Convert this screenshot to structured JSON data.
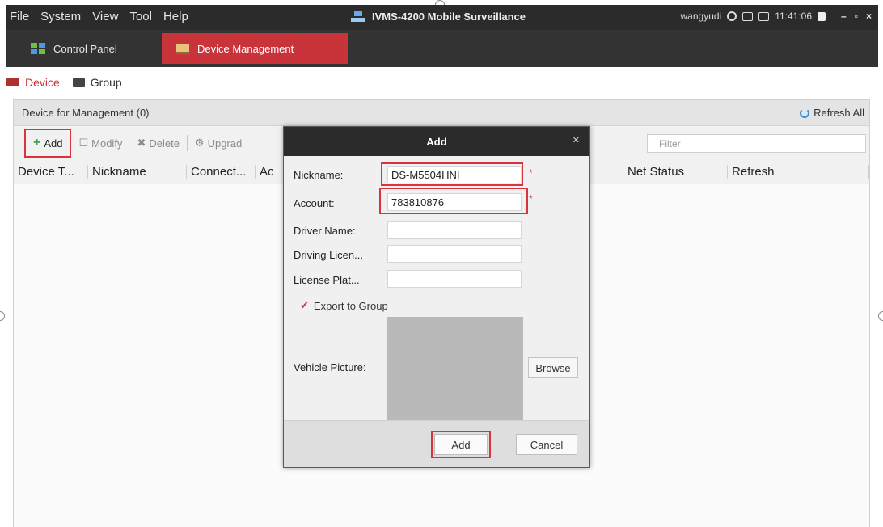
{
  "menu": [
    "File",
    "System",
    "View",
    "Tool",
    "Help"
  ],
  "app_title": "IVMS-4200 Mobile Surveillance",
  "status": {
    "user": "wangyudi",
    "time": "11:41:06"
  },
  "tabs": {
    "control_panel": "Control Panel",
    "device_management": "Device Management"
  },
  "subtabs": {
    "device": "Device",
    "group": "Group"
  },
  "panel": {
    "title": "Device for Management (0)",
    "refresh_all": "Refresh All"
  },
  "toolbar": {
    "add": "Add",
    "modify": "Modify",
    "delete": "Delete",
    "upgrade": "Upgrad",
    "filter_placeholder": "Filter"
  },
  "columns": [
    "Device T...",
    "Nickname",
    "Connect...",
    "Ac",
    "Net Status",
    "Refresh"
  ],
  "dialog": {
    "title": "Add",
    "nickname_label": "Nickname:",
    "nickname_value": "DS-M5504HNI",
    "account_label": "Account:",
    "account_value": "783810876",
    "driver_label": "Driver Name:",
    "driving_label": "Driving Licen...",
    "plate_label": "License Plat...",
    "export_label": "Export to Group",
    "vehicle_label": "Vehicle Picture:",
    "browse": "Browse",
    "add_button": "Add",
    "cancel_button": "Cancel"
  }
}
